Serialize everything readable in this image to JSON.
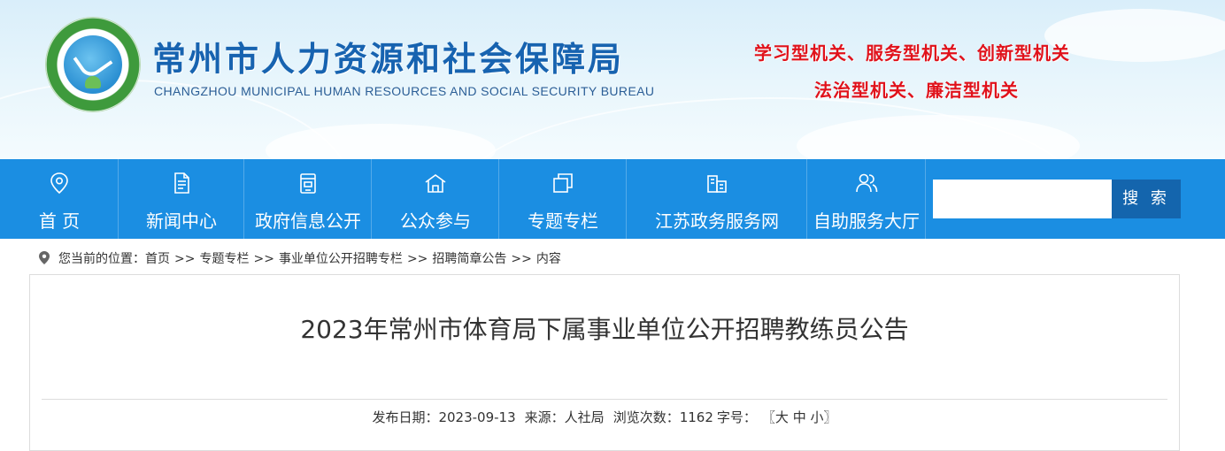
{
  "header": {
    "title": "常州市人力资源和社会保障局",
    "subtitle": "CHANGZHOU MUNICIPAL HUMAN RESOURCES AND SOCIAL SECURITY BUREAU",
    "slogan_line1": "学习型机关、服务型机关、创新型机关",
    "slogan_line2": "法治型机关、廉洁型机关",
    "title_color": "#1763b0",
    "slogan_color": "#e0121b"
  },
  "nav": {
    "items": [
      {
        "label": "首 页",
        "icon": "location-pin-icon"
      },
      {
        "label": "新闻中心",
        "icon": "document-icon"
      },
      {
        "label": "政府信息公开",
        "icon": "archive-icon"
      },
      {
        "label": "公众参与",
        "icon": "house-icon"
      },
      {
        "label": "专题专栏",
        "icon": "stacked-windows-icon"
      },
      {
        "label": "江苏政务服务网",
        "icon": "building-icon"
      },
      {
        "label": "自助服务大厅",
        "icon": "users-icon"
      }
    ],
    "search_button": "搜 索",
    "search_placeholder": "",
    "bar_color": "#1b8ee2"
  },
  "breadcrumb": {
    "prefix": "您当前的位置：",
    "items": [
      "首页",
      "专题专栏",
      "事业单位公开招聘专栏",
      "招聘简章公告",
      "内容"
    ],
    "separator": ">>"
  },
  "article": {
    "title": "2023年常州市体育局下属事业单位公开招聘教练员公告",
    "publish_label": "发布日期：",
    "publish_date": "2023-09-13",
    "source_label": "来源：",
    "source": "人社局",
    "views_label": "浏览次数：",
    "views": "1162",
    "fontsize_label": "字号：",
    "fontsize_open": "〖",
    "fontsize_large": "大",
    "fontsize_medium": "中",
    "fontsize_small": "小",
    "fontsize_close": "〗"
  }
}
